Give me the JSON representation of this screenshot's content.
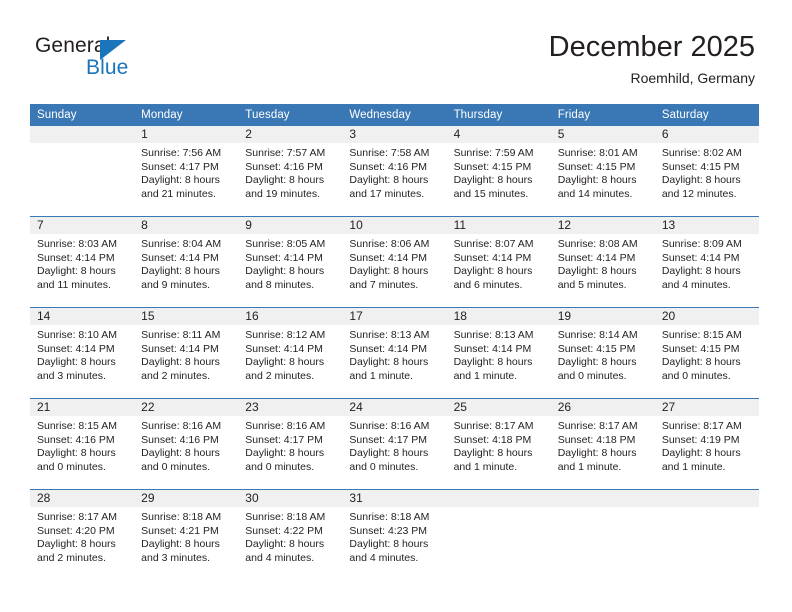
{
  "brand": {
    "name_part1": "General",
    "name_part2": "Blue",
    "accent_color": "#1b75bb"
  },
  "header": {
    "title": "December 2025",
    "subtitle": "Roemhild, Germany",
    "header_bg_color": "#3a77b5",
    "daynum_bg_color": "#f0f0f0"
  },
  "weekdays": [
    "Sunday",
    "Monday",
    "Tuesday",
    "Wednesday",
    "Thursday",
    "Friday",
    "Saturday"
  ],
  "labels": {
    "sunrise": "Sunrise:",
    "sunset": "Sunset:",
    "daylight": "Daylight:"
  },
  "weeks": [
    [
      {
        "day": "",
        "sunrise": "",
        "sunset": "",
        "daylight_line1": "",
        "daylight_line2": ""
      },
      {
        "day": "1",
        "sunrise": "Sunrise: 7:56 AM",
        "sunset": "Sunset: 4:17 PM",
        "daylight_line1": "Daylight: 8 hours",
        "daylight_line2": "and 21 minutes."
      },
      {
        "day": "2",
        "sunrise": "Sunrise: 7:57 AM",
        "sunset": "Sunset: 4:16 PM",
        "daylight_line1": "Daylight: 8 hours",
        "daylight_line2": "and 19 minutes."
      },
      {
        "day": "3",
        "sunrise": "Sunrise: 7:58 AM",
        "sunset": "Sunset: 4:16 PM",
        "daylight_line1": "Daylight: 8 hours",
        "daylight_line2": "and 17 minutes."
      },
      {
        "day": "4",
        "sunrise": "Sunrise: 7:59 AM",
        "sunset": "Sunset: 4:15 PM",
        "daylight_line1": "Daylight: 8 hours",
        "daylight_line2": "and 15 minutes."
      },
      {
        "day": "5",
        "sunrise": "Sunrise: 8:01 AM",
        "sunset": "Sunset: 4:15 PM",
        "daylight_line1": "Daylight: 8 hours",
        "daylight_line2": "and 14 minutes."
      },
      {
        "day": "6",
        "sunrise": "Sunrise: 8:02 AM",
        "sunset": "Sunset: 4:15 PM",
        "daylight_line1": "Daylight: 8 hours",
        "daylight_line2": "and 12 minutes."
      }
    ],
    [
      {
        "day": "7",
        "sunrise": "Sunrise: 8:03 AM",
        "sunset": "Sunset: 4:14 PM",
        "daylight_line1": "Daylight: 8 hours",
        "daylight_line2": "and 11 minutes."
      },
      {
        "day": "8",
        "sunrise": "Sunrise: 8:04 AM",
        "sunset": "Sunset: 4:14 PM",
        "daylight_line1": "Daylight: 8 hours",
        "daylight_line2": "and 9 minutes."
      },
      {
        "day": "9",
        "sunrise": "Sunrise: 8:05 AM",
        "sunset": "Sunset: 4:14 PM",
        "daylight_line1": "Daylight: 8 hours",
        "daylight_line2": "and 8 minutes."
      },
      {
        "day": "10",
        "sunrise": "Sunrise: 8:06 AM",
        "sunset": "Sunset: 4:14 PM",
        "daylight_line1": "Daylight: 8 hours",
        "daylight_line2": "and 7 minutes."
      },
      {
        "day": "11",
        "sunrise": "Sunrise: 8:07 AM",
        "sunset": "Sunset: 4:14 PM",
        "daylight_line1": "Daylight: 8 hours",
        "daylight_line2": "and 6 minutes."
      },
      {
        "day": "12",
        "sunrise": "Sunrise: 8:08 AM",
        "sunset": "Sunset: 4:14 PM",
        "daylight_line1": "Daylight: 8 hours",
        "daylight_line2": "and 5 minutes."
      },
      {
        "day": "13",
        "sunrise": "Sunrise: 8:09 AM",
        "sunset": "Sunset: 4:14 PM",
        "daylight_line1": "Daylight: 8 hours",
        "daylight_line2": "and 4 minutes."
      }
    ],
    [
      {
        "day": "14",
        "sunrise": "Sunrise: 8:10 AM",
        "sunset": "Sunset: 4:14 PM",
        "daylight_line1": "Daylight: 8 hours",
        "daylight_line2": "and 3 minutes."
      },
      {
        "day": "15",
        "sunrise": "Sunrise: 8:11 AM",
        "sunset": "Sunset: 4:14 PM",
        "daylight_line1": "Daylight: 8 hours",
        "daylight_line2": "and 2 minutes."
      },
      {
        "day": "16",
        "sunrise": "Sunrise: 8:12 AM",
        "sunset": "Sunset: 4:14 PM",
        "daylight_line1": "Daylight: 8 hours",
        "daylight_line2": "and 2 minutes."
      },
      {
        "day": "17",
        "sunrise": "Sunrise: 8:13 AM",
        "sunset": "Sunset: 4:14 PM",
        "daylight_line1": "Daylight: 8 hours",
        "daylight_line2": "and 1 minute."
      },
      {
        "day": "18",
        "sunrise": "Sunrise: 8:13 AM",
        "sunset": "Sunset: 4:14 PM",
        "daylight_line1": "Daylight: 8 hours",
        "daylight_line2": "and 1 minute."
      },
      {
        "day": "19",
        "sunrise": "Sunrise: 8:14 AM",
        "sunset": "Sunset: 4:15 PM",
        "daylight_line1": "Daylight: 8 hours",
        "daylight_line2": "and 0 minutes."
      },
      {
        "day": "20",
        "sunrise": "Sunrise: 8:15 AM",
        "sunset": "Sunset: 4:15 PM",
        "daylight_line1": "Daylight: 8 hours",
        "daylight_line2": "and 0 minutes."
      }
    ],
    [
      {
        "day": "21",
        "sunrise": "Sunrise: 8:15 AM",
        "sunset": "Sunset: 4:16 PM",
        "daylight_line1": "Daylight: 8 hours",
        "daylight_line2": "and 0 minutes."
      },
      {
        "day": "22",
        "sunrise": "Sunrise: 8:16 AM",
        "sunset": "Sunset: 4:16 PM",
        "daylight_line1": "Daylight: 8 hours",
        "daylight_line2": "and 0 minutes."
      },
      {
        "day": "23",
        "sunrise": "Sunrise: 8:16 AM",
        "sunset": "Sunset: 4:17 PM",
        "daylight_line1": "Daylight: 8 hours",
        "daylight_line2": "and 0 minutes."
      },
      {
        "day": "24",
        "sunrise": "Sunrise: 8:16 AM",
        "sunset": "Sunset: 4:17 PM",
        "daylight_line1": "Daylight: 8 hours",
        "daylight_line2": "and 0 minutes."
      },
      {
        "day": "25",
        "sunrise": "Sunrise: 8:17 AM",
        "sunset": "Sunset: 4:18 PM",
        "daylight_line1": "Daylight: 8 hours",
        "daylight_line2": "and 1 minute."
      },
      {
        "day": "26",
        "sunrise": "Sunrise: 8:17 AM",
        "sunset": "Sunset: 4:18 PM",
        "daylight_line1": "Daylight: 8 hours",
        "daylight_line2": "and 1 minute."
      },
      {
        "day": "27",
        "sunrise": "Sunrise: 8:17 AM",
        "sunset": "Sunset: 4:19 PM",
        "daylight_line1": "Daylight: 8 hours",
        "daylight_line2": "and 1 minute."
      }
    ],
    [
      {
        "day": "28",
        "sunrise": "Sunrise: 8:17 AM",
        "sunset": "Sunset: 4:20 PM",
        "daylight_line1": "Daylight: 8 hours",
        "daylight_line2": "and 2 minutes."
      },
      {
        "day": "29",
        "sunrise": "Sunrise: 8:18 AM",
        "sunset": "Sunset: 4:21 PM",
        "daylight_line1": "Daylight: 8 hours",
        "daylight_line2": "and 3 minutes."
      },
      {
        "day": "30",
        "sunrise": "Sunrise: 8:18 AM",
        "sunset": "Sunset: 4:22 PM",
        "daylight_line1": "Daylight: 8 hours",
        "daylight_line2": "and 4 minutes."
      },
      {
        "day": "31",
        "sunrise": "Sunrise: 8:18 AM",
        "sunset": "Sunset: 4:23 PM",
        "daylight_line1": "Daylight: 8 hours",
        "daylight_line2": "and 4 minutes."
      },
      {
        "day": "",
        "sunrise": "",
        "sunset": "",
        "daylight_line1": "",
        "daylight_line2": ""
      },
      {
        "day": "",
        "sunrise": "",
        "sunset": "",
        "daylight_line1": "",
        "daylight_line2": ""
      },
      {
        "day": "",
        "sunrise": "",
        "sunset": "",
        "daylight_line1": "",
        "daylight_line2": ""
      }
    ]
  ]
}
